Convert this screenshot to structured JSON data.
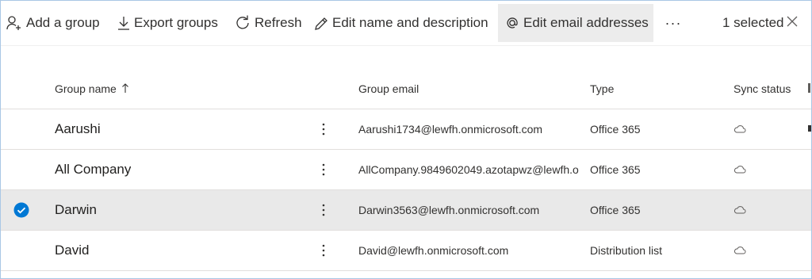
{
  "toolbar": {
    "add_group": "Add a group",
    "export_groups": "Export groups",
    "refresh": "Refresh",
    "edit_name": "Edit name and description",
    "edit_email": "Edit email addresses",
    "more": "···",
    "selected": "1 selected"
  },
  "columns": {
    "group_name": "Group name",
    "group_email": "Group email",
    "type": "Type",
    "sync_status": "Sync status"
  },
  "rows": [
    {
      "name": "Aarushi",
      "email": "Aarushi1734@lewfh.onmicrosoft.com",
      "type": "Office 365",
      "sync": "cloud-icon",
      "selected": false
    },
    {
      "name": "All Company",
      "email": "AllCompany.9849602049.azotapwz@lewfh.o",
      "type": "Office 365",
      "sync": "cloud-icon",
      "selected": false
    },
    {
      "name": "Darwin",
      "email": "Darwin3563@lewfh.onmicrosoft.com",
      "type": "Office 365",
      "sync": "cloud-icon",
      "selected": true
    },
    {
      "name": "David",
      "email": "David@lewfh.onmicrosoft.com",
      "type": "Distribution list",
      "sync": "cloud-icon",
      "selected": false
    }
  ],
  "colors": {
    "accent": "#0078d4",
    "selected_row": "#e9e9e9",
    "active_button": "#ececec"
  }
}
